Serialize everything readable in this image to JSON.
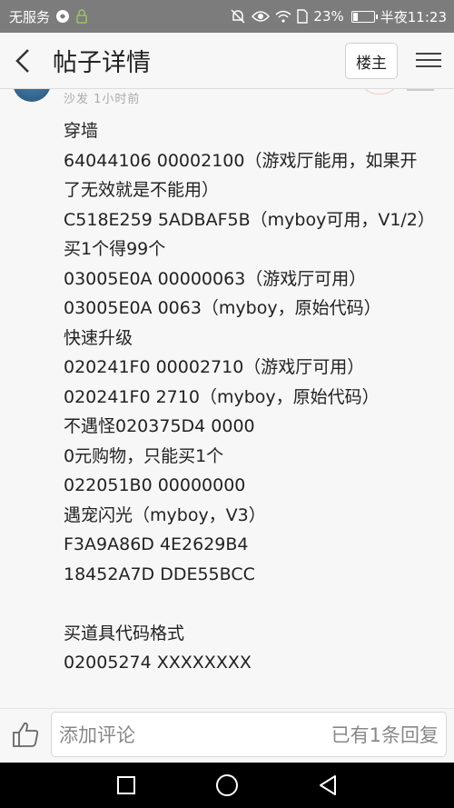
{
  "status_bar": {
    "carrier": "无服务",
    "battery": "23%",
    "time": "半夜11:23",
    "battery_level": 0.23
  },
  "header": {
    "title": "帖子详情",
    "op_label": "楼主"
  },
  "post": {
    "meta": "沙发  1小时前",
    "lines": [
      "穿墙",
      "64044106 00002100（游戏厅能用，如果开",
      "了无效就是不能用）",
      "C518E259 5ADBAF5B（myboy可用，V1/2）",
      "买1个得99个",
      "03005E0A 00000063（游戏厅可用）",
      "03005E0A 0063（myboy，原始代码）",
      "快速升级",
      "020241F0 00002710（游戏厅可用）",
      "020241F0 2710（myboy，原始代码）",
      "不遇怪020375D4 0000",
      "0元购物，只能买1个",
      "022051B0 00000000",
      "遇宠闪光（myboy，V3）",
      "F3A9A86D 4E2629B4",
      "18452A7D DDE55BCC",
      "",
      "买道具代码格式",
      "02005274 XXXXXXXX"
    ]
  },
  "comment_bar": {
    "placeholder": "添加评论",
    "reply_count": "已有1条回复"
  },
  "icons": {
    "back": "back-arrow-icon",
    "menu": "hamburger-menu-icon",
    "like": "thumbs-up-icon",
    "nav_recent": "square-recent-apps-icon",
    "nav_home": "circle-home-icon",
    "nav_back": "triangle-back-icon"
  }
}
